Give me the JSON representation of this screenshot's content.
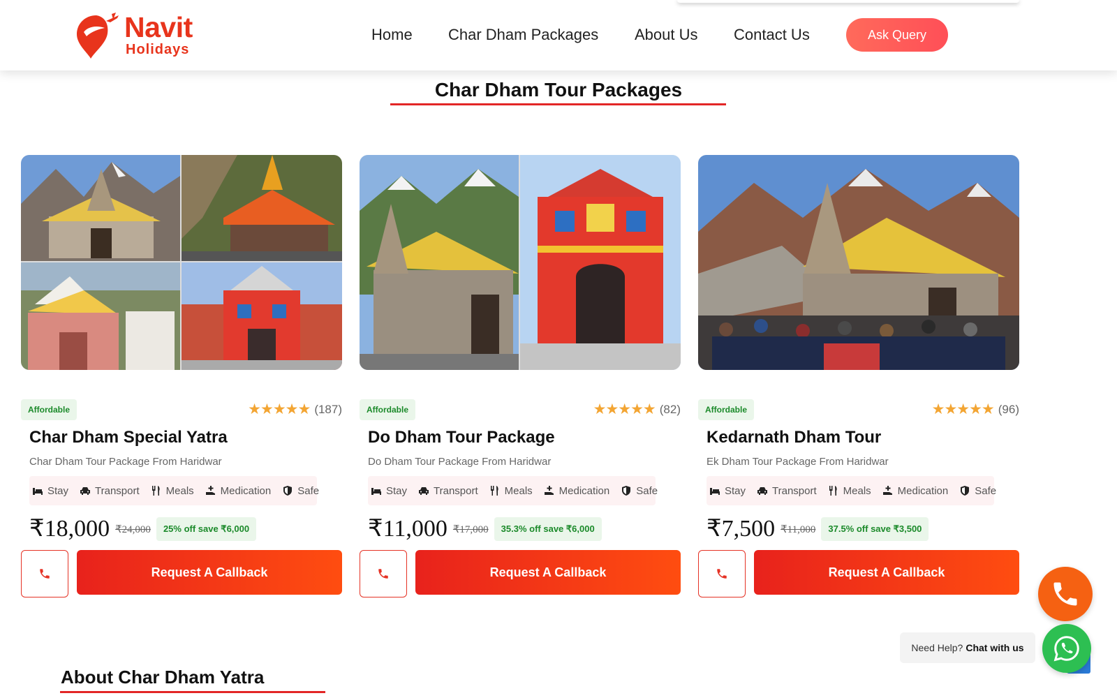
{
  "brand": {
    "name": "Navit",
    "tagline": "Holidays",
    "accent": "#e8341c"
  },
  "nav": {
    "items": [
      "Home",
      "Char Dham Packages",
      "About Us",
      "Contact Us"
    ],
    "cta": "Ask Query"
  },
  "section": {
    "title": "Char Dham Tour Packages"
  },
  "cards": [
    {
      "badge": "Affordable",
      "stars": "★★★★★",
      "rating_count": "(187)",
      "title": "Char Dham Special Yatra",
      "subtitle": "Char Dham Tour Package From Haridwar",
      "amenities": [
        "Stay",
        "Transport",
        "Meals",
        "Medication",
        "Safe"
      ],
      "price": "₹18,000",
      "old_price": "₹24,000",
      "discount": "25% off  save ₹6,000",
      "cta": "Request A Callback"
    },
    {
      "badge": "Affordable",
      "stars": "★★★★★",
      "rating_count": "(82)",
      "title": "Do Dham Tour Package",
      "subtitle": "Do Dham Tour Package From Haridwar",
      "amenities": [
        "Stay",
        "Transport",
        "Meals",
        "Medication",
        "Safe"
      ],
      "price": "₹11,000",
      "old_price": "₹17,000",
      "discount": "35.3% off  save ₹6,000",
      "cta": "Request A Callback"
    },
    {
      "badge": "Affordable",
      "stars": "★★★★★",
      "rating_count": "(96)",
      "title": "Kedarnath Dham Tour",
      "subtitle": "Ek Dham Tour Package From Haridwar",
      "amenities": [
        "Stay",
        "Transport",
        "Meals",
        "Medication",
        "Safe"
      ],
      "price": "₹7,500",
      "old_price": "₹11,000",
      "discount": "37.5% off  save ₹3,500",
      "cta": "Request A Callback"
    }
  ],
  "help": {
    "prefix": "Need Help?",
    "action": "Chat with us"
  },
  "about": {
    "title": "About Char Dham Yatra"
  },
  "colors": {
    "primary": "#e8221c",
    "secondary": "#ff4d10",
    "success": "#1b8a2a",
    "star": "#f3a533",
    "whatsapp": "#2dbf52",
    "phone_fab": "#f56112"
  }
}
